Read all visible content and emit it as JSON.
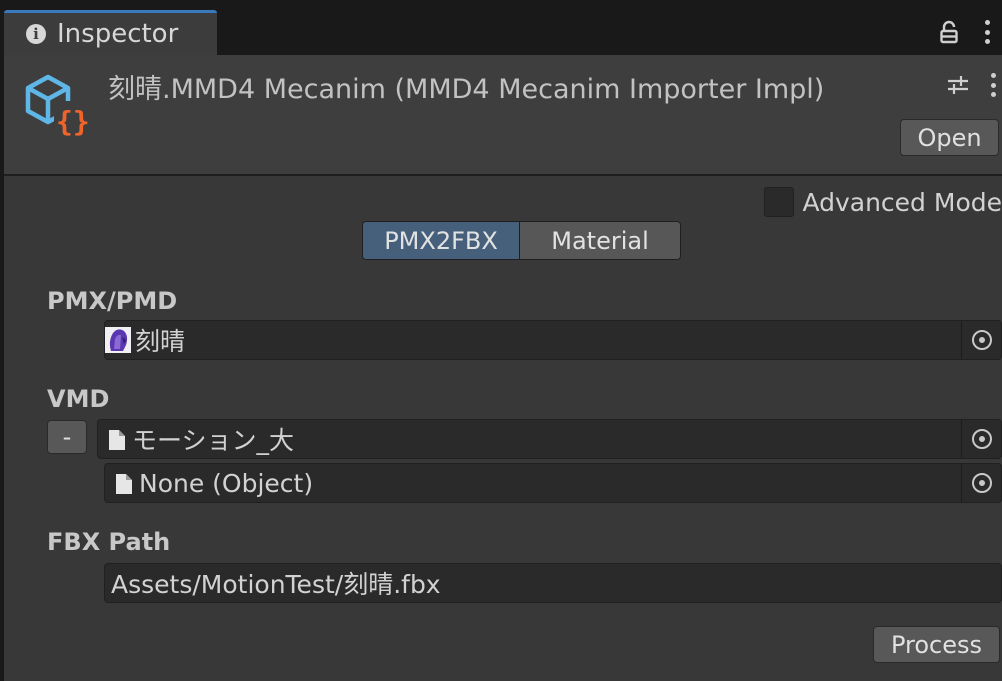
{
  "tab": {
    "title": "Inspector",
    "icon": "info-icon"
  },
  "tab_actions": {
    "lock_icon": "lock-icon",
    "menu_icon": "kebab-menu-icon"
  },
  "header": {
    "asset_icon": "script-cube-icon",
    "title": "刻晴.MMD4 Mecanim (MMD4 Mecanim Importer Impl)",
    "presets_icon": "presets-icon",
    "menu_icon": "kebab-menu-icon",
    "open_label": "Open"
  },
  "advanced_mode": {
    "label": "Advanced Mode",
    "checked": false
  },
  "tabs": [
    {
      "label": "PMX2FBX",
      "active": true
    },
    {
      "label": "Material",
      "active": false
    }
  ],
  "pmx": {
    "label": "PMX/PMD",
    "value": "刻晴",
    "icon": "model-icon"
  },
  "vmd": {
    "label": "VMD",
    "remove_label": "-",
    "items": [
      {
        "value": "モーション_大",
        "icon": "document-icon"
      },
      {
        "value": "None (Object)",
        "icon": "document-icon"
      }
    ]
  },
  "fbx": {
    "label": "FBX Path",
    "value": "Assets/MotionTest/刻晴.fbx"
  },
  "process_label": "Process",
  "colors": {
    "accent": "#3a79bb",
    "active_tab": "#46607c",
    "panel": "#383838",
    "field": "#2a2a2a",
    "icon_blue": "#5fb7e8",
    "icon_orange": "#f0642a"
  }
}
